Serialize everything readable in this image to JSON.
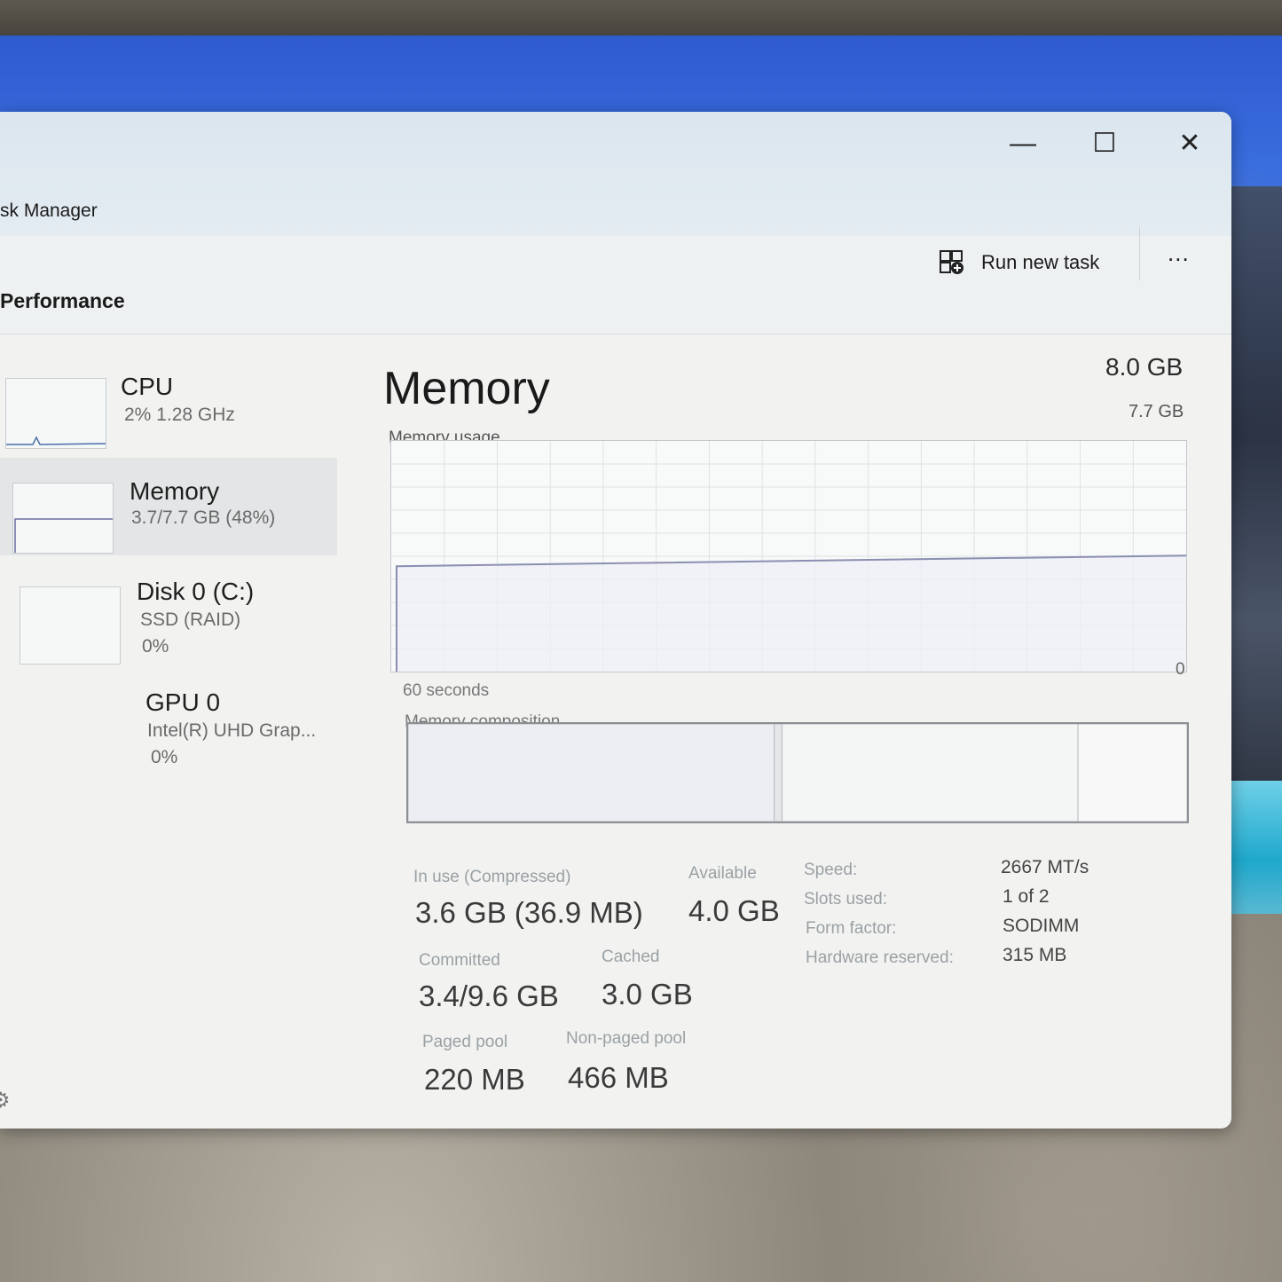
{
  "window": {
    "title": "sk Manager",
    "minimize_glyph": "—",
    "maximize_glyph": "☐",
    "close_glyph": "✕"
  },
  "page": {
    "heading": "Performance"
  },
  "toolbar": {
    "run_new_task_label": "Run new task",
    "run_new_task_icon": "run-task-icon",
    "more_label": "..."
  },
  "sidebar": {
    "items": [
      {
        "name": "CPU",
        "sub1": "2% 1.28 GHz",
        "sub2": ""
      },
      {
        "name": "Memory",
        "sub1": "3.7/7.7 GB (48%)",
        "sub2": ""
      },
      {
        "name": "Disk 0 (C:)",
        "sub1": "SSD (RAID)",
        "sub2": "0%"
      },
      {
        "name": "GPU 0",
        "sub1": "Intel(R) UHD Grap...",
        "sub2": "0%"
      }
    ],
    "selected_index": 1,
    "settings_icon": "gear-icon"
  },
  "memory": {
    "title": "Memory",
    "total": "8.0 GB",
    "graph_max": "7.7 GB",
    "usage_label": "Memory usage",
    "graph_min": "0",
    "time_span": "60 seconds",
    "composition_label": "Memory composition",
    "usage_fraction": 0.48,
    "composition": {
      "in_use_fraction": 0.47,
      "modified_fraction": 0.01,
      "standby_fraction": 0.38,
      "free_fraction": 0.14
    }
  },
  "stats": {
    "in_use_label": "In use (Compressed)",
    "in_use_value": "3.6 GB (36.9 MB)",
    "available_label": "Available",
    "available_value": "4.0 GB",
    "committed_label": "Committed",
    "committed_value": "3.4/9.6 GB",
    "cached_label": "Cached",
    "cached_value": "3.0 GB",
    "paged_pool_label": "Paged pool",
    "paged_pool_value": "220 MB",
    "non_paged_pool_label": "Non-paged pool",
    "non_paged_pool_value": "466 MB"
  },
  "specs": {
    "speed_label": "Speed:",
    "speed_value": "2667 MT/s",
    "slots_label": "Slots used:",
    "slots_value": "1 of 2",
    "form_label": "Form factor:",
    "form_value": "SODIMM",
    "hw_label": "Hardware reserved:",
    "hw_value": "315 MB"
  },
  "colors": {
    "graph_line": "#8a8fb0",
    "graph_fill": "#eef0f6",
    "grid": "#dfe2e4",
    "comp_border": "#8c8f93",
    "comp_divider": "#b8bbbe"
  }
}
